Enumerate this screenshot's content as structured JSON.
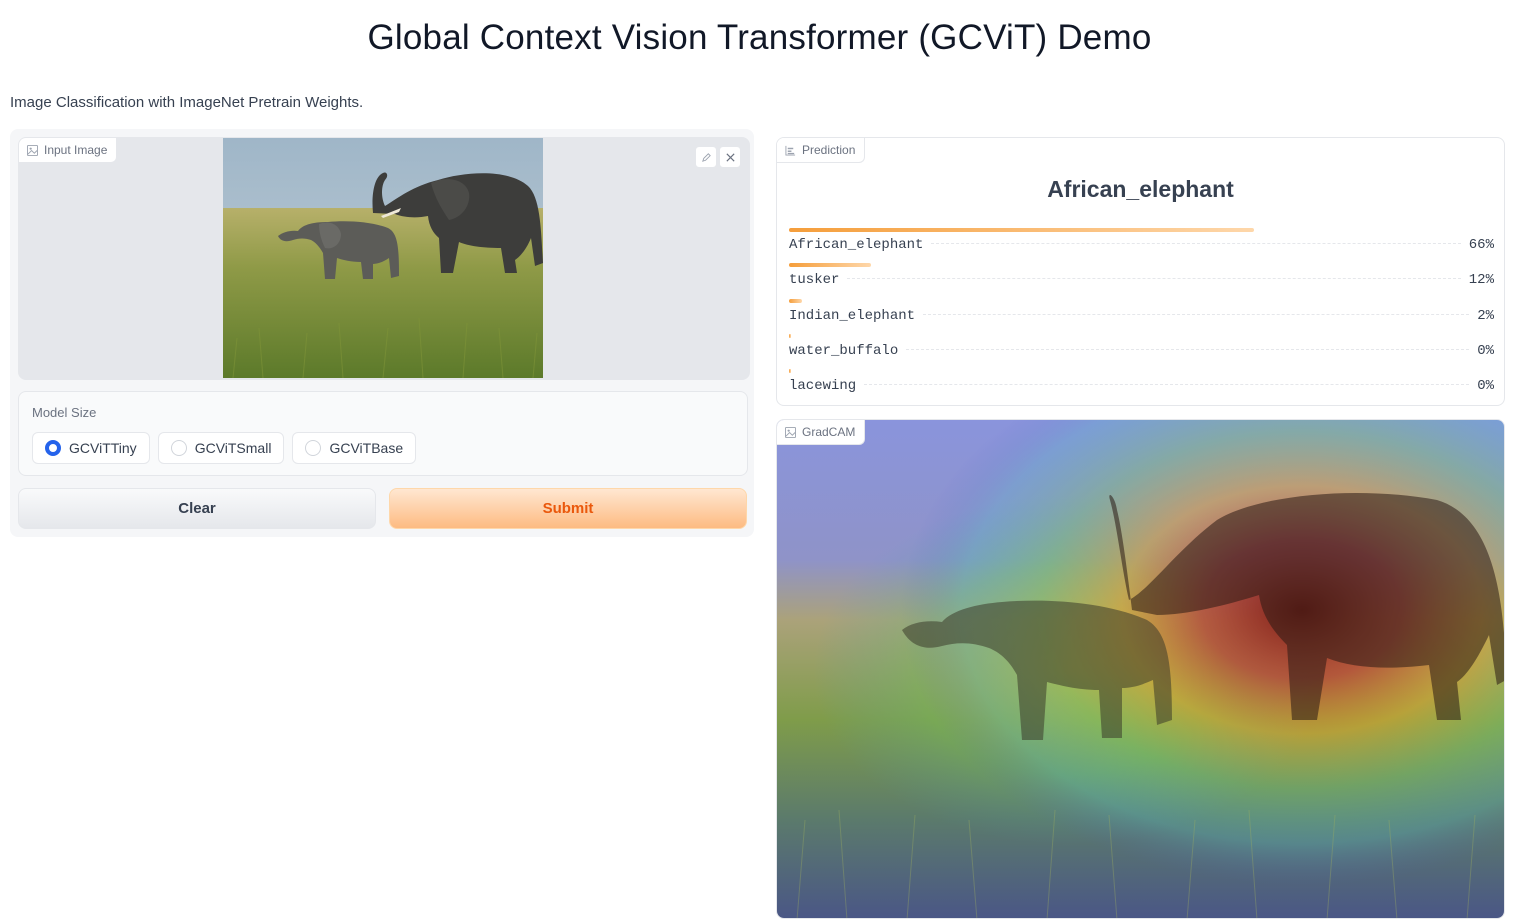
{
  "header": {
    "title": "Global Context Vision Transformer (GCViT) Demo",
    "description": "Image Classification with ImageNet Pretrain Weights."
  },
  "input_image": {
    "label": "Input Image",
    "icon": "image-icon",
    "tools": [
      "edit-icon",
      "close-icon"
    ]
  },
  "model_size": {
    "label": "Model Size",
    "options": [
      {
        "label": "GCViTTiny",
        "selected": true
      },
      {
        "label": "GCViTSmall",
        "selected": false
      },
      {
        "label": "GCViTBase",
        "selected": false
      }
    ]
  },
  "buttons": {
    "clear": "Clear",
    "submit": "Submit"
  },
  "prediction": {
    "label": "Prediction",
    "icon": "bar-chart-icon",
    "top_label": "African_elephant",
    "confidences": [
      {
        "label": "African_elephant",
        "pct": "66%",
        "value": 0.66
      },
      {
        "label": "tusker",
        "pct": "12%",
        "value": 0.117
      },
      {
        "label": "Indian_elephant",
        "pct": "2%",
        "value": 0.018
      },
      {
        "label": "water_buffalo",
        "pct": "0%",
        "value": 0.002
      },
      {
        "label": "lacewing",
        "pct": "0%",
        "value": 0.001
      }
    ]
  },
  "gradcam": {
    "label": "GradCAM",
    "icon": "image-icon"
  },
  "colors": {
    "accent_orange": "#f59e3b",
    "submit_text": "#ea580c",
    "radio_selected": "#2563eb"
  }
}
